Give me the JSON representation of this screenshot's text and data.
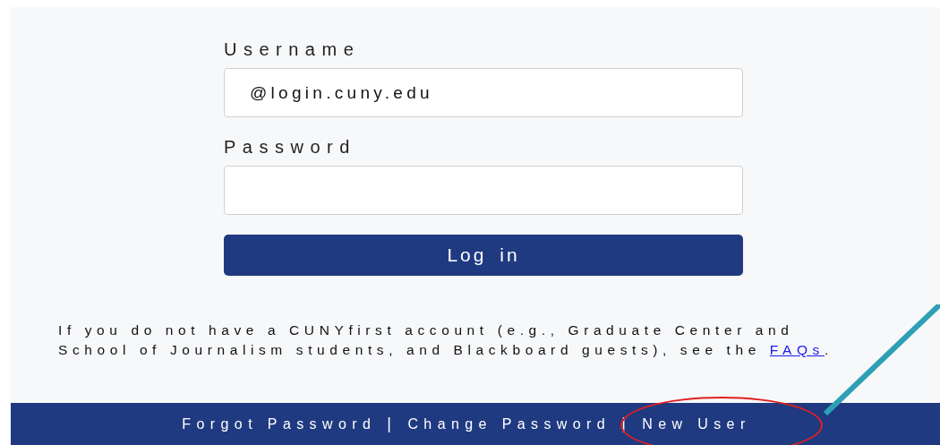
{
  "form": {
    "username": {
      "label": "Username",
      "value": "@login.cuny.edu"
    },
    "password": {
      "label": "Password"
    },
    "submit": "Log in"
  },
  "notice": {
    "text": "If you do not have a CUNYfirst account (e.g., Graduate Center and School of Journalism students, and Blackboard guests), see the ",
    "link": "FAQs",
    "after": "."
  },
  "footer": {
    "separator": "|",
    "links": [
      {
        "label": "Forgot Password",
        "annotated": false
      },
      {
        "label": "Change Password",
        "annotated": false
      },
      {
        "label": "New User",
        "annotated": true
      }
    ]
  }
}
